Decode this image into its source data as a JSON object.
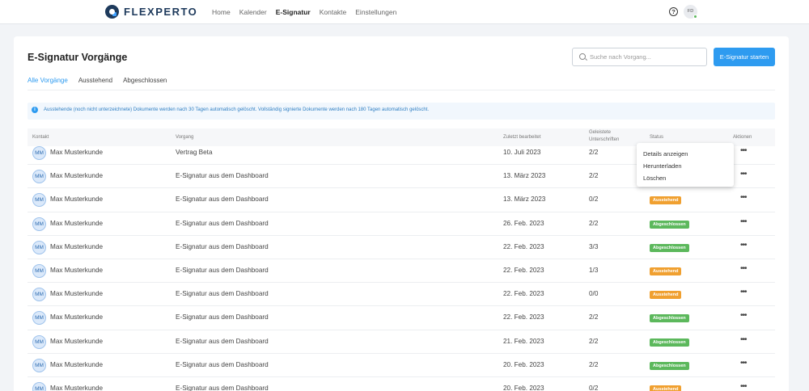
{
  "brand": {
    "name": "FLEXPERTO"
  },
  "nav": {
    "items": [
      {
        "label": "Home",
        "active": false
      },
      {
        "label": "Kalender",
        "active": false
      },
      {
        "label": "E-Signatur",
        "active": true
      },
      {
        "label": "Kontakte",
        "active": false
      },
      {
        "label": "Einstellungen",
        "active": false
      }
    ],
    "help_icon": "?",
    "user_initials": "FD"
  },
  "page": {
    "title": "E-Signatur Vorgänge",
    "search_placeholder": "Suche nach Vorgang...",
    "start_button": "E-Signatur starten"
  },
  "tabs": [
    {
      "label": "Alle Vorgänge",
      "active": true
    },
    {
      "label": "Ausstehend",
      "active": false
    },
    {
      "label": "Abgeschlossen",
      "active": false
    }
  ],
  "info": {
    "icon": "i",
    "text": "Ausstehende (noch nicht unterzeichnete) Dokumente werden nach 30 Tagen automatisch gelöscht. Vollständig signierte Dokumente werden nach 180 Tagen automatisch gelöscht."
  },
  "table": {
    "columns": {
      "contact": "Kontakt",
      "process": "Vorgang",
      "edited": "Zuletzt bearbeitet",
      "signatures_1": "Geleistete",
      "signatures_2": "Unterschriften",
      "status": "Status",
      "actions": "Aktionen"
    },
    "rows": [
      {
        "initials": "MM",
        "contact": "Max Musterkunde",
        "process": "Vertrag Beta",
        "edited": "10. Juli 2023",
        "signatures": "2/2",
        "status": "",
        "status_type": "",
        "actions": "•••"
      },
      {
        "initials": "MM",
        "contact": "Max Musterkunde",
        "process": "E-Signatur aus dem Dashboard",
        "edited": "13. März 2023",
        "signatures": "2/2",
        "status": "",
        "status_type": "",
        "actions": "•••"
      },
      {
        "initials": "MM",
        "contact": "Max Musterkunde",
        "process": "E-Signatur aus dem Dashboard",
        "edited": "13. März 2023",
        "signatures": "0/2",
        "status": "Ausstehend",
        "status_type": "pend",
        "actions": "•••"
      },
      {
        "initials": "MM",
        "contact": "Max Musterkunde",
        "process": "E-Signatur aus dem Dashboard",
        "edited": "26. Feb. 2023",
        "signatures": "2/2",
        "status": "Abgeschlossen",
        "status_type": "ok",
        "actions": "•••"
      },
      {
        "initials": "MM",
        "contact": "Max Musterkunde",
        "process": "E-Signatur aus dem Dashboard",
        "edited": "22. Feb. 2023",
        "signatures": "3/3",
        "status": "Abgeschlossen",
        "status_type": "ok",
        "actions": "•••"
      },
      {
        "initials": "MM",
        "contact": "Max Musterkunde",
        "process": "E-Signatur aus dem Dashboard",
        "edited": "22. Feb. 2023",
        "signatures": "1/3",
        "status": "Ausstehend",
        "status_type": "pend",
        "actions": "•••"
      },
      {
        "initials": "MM",
        "contact": "Max Musterkunde",
        "process": "E-Signatur aus dem Dashboard",
        "edited": "22. Feb. 2023",
        "signatures": "0/0",
        "status": "Ausstehend",
        "status_type": "pend",
        "actions": "•••"
      },
      {
        "initials": "MM",
        "contact": "Max Musterkunde",
        "process": "E-Signatur aus dem Dashboard",
        "edited": "22. Feb. 2023",
        "signatures": "2/2",
        "status": "Abgeschlossen",
        "status_type": "ok",
        "actions": "•••"
      },
      {
        "initials": "MM",
        "contact": "Max Musterkunde",
        "process": "E-Signatur aus dem Dashboard",
        "edited": "21. Feb. 2023",
        "signatures": "2/2",
        "status": "Abgeschlossen",
        "status_type": "ok",
        "actions": "•••"
      },
      {
        "initials": "MM",
        "contact": "Max Musterkunde",
        "process": "E-Signatur aus dem Dashboard",
        "edited": "20. Feb. 2023",
        "signatures": "2/2",
        "status": "Abgeschlossen",
        "status_type": "ok",
        "actions": "•••"
      },
      {
        "initials": "MM",
        "contact": "Max Musterkunde",
        "process": "E-Signatur aus dem Dashboard",
        "edited": "20. Feb. 2023",
        "signatures": "0/2",
        "status": "Ausstehend",
        "status_type": "pend",
        "actions": "•••"
      }
    ]
  },
  "dropdown": {
    "items": [
      "Details anzeigen",
      "Herunterladen",
      "Löschen"
    ]
  },
  "colors": {
    "accent": "#2e9bf0",
    "success": "#5cb85c",
    "warning": "#f0a030",
    "brand_dark": "#1e3a5c"
  }
}
